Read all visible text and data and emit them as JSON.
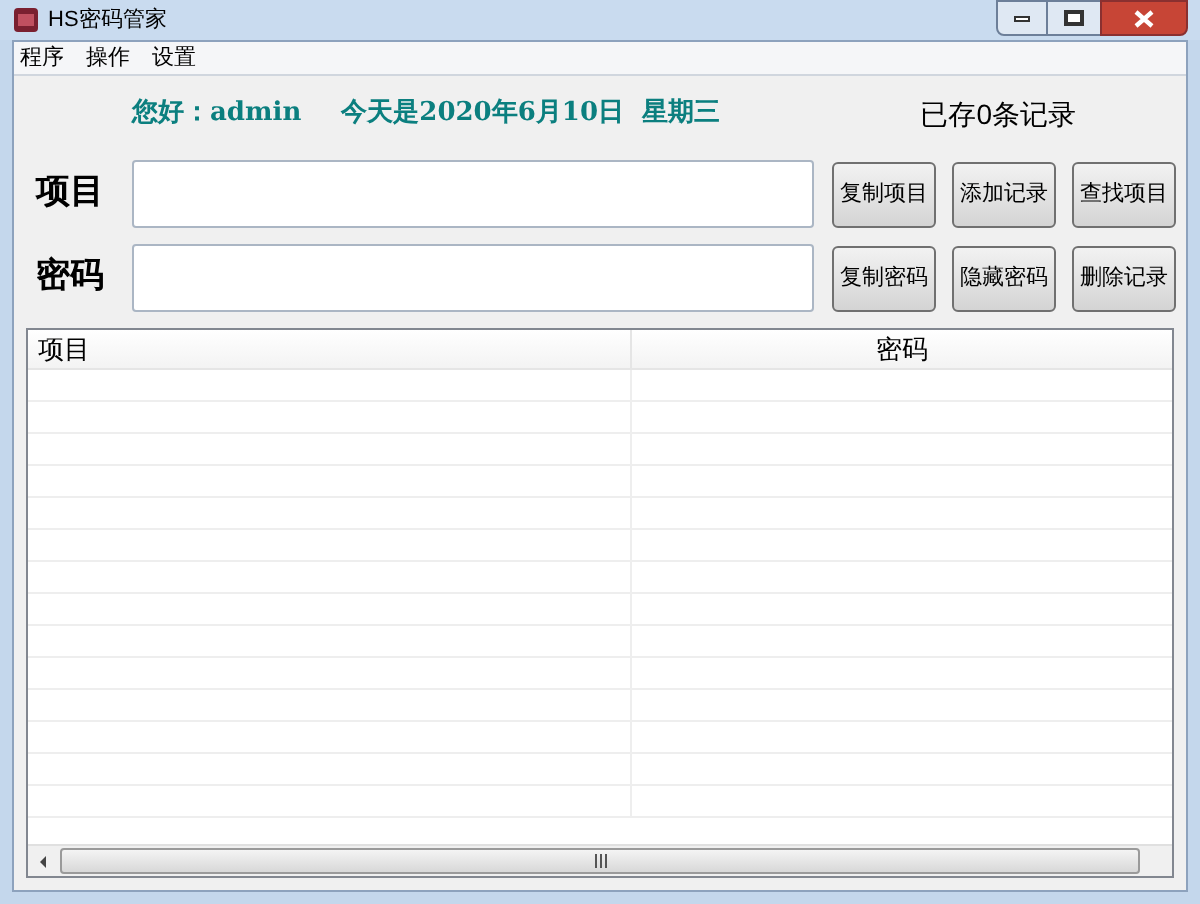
{
  "window": {
    "title": "HS密码管家"
  },
  "menu": [
    "程序",
    "操作",
    "设置"
  ],
  "greeting": "您好：admin",
  "date": "今天是2020年6月10日  星期三",
  "record_count": "已存0条记录",
  "form": [
    {
      "label": "项目",
      "buttons": [
        "复制项目",
        "添加记录",
        "查找项目"
      ]
    },
    {
      "label": "密码",
      "buttons": [
        "复制密码",
        "隐藏密码",
        "删除记录"
      ]
    }
  ],
  "table": {
    "columns": [
      "项目",
      "密码"
    ]
  }
}
